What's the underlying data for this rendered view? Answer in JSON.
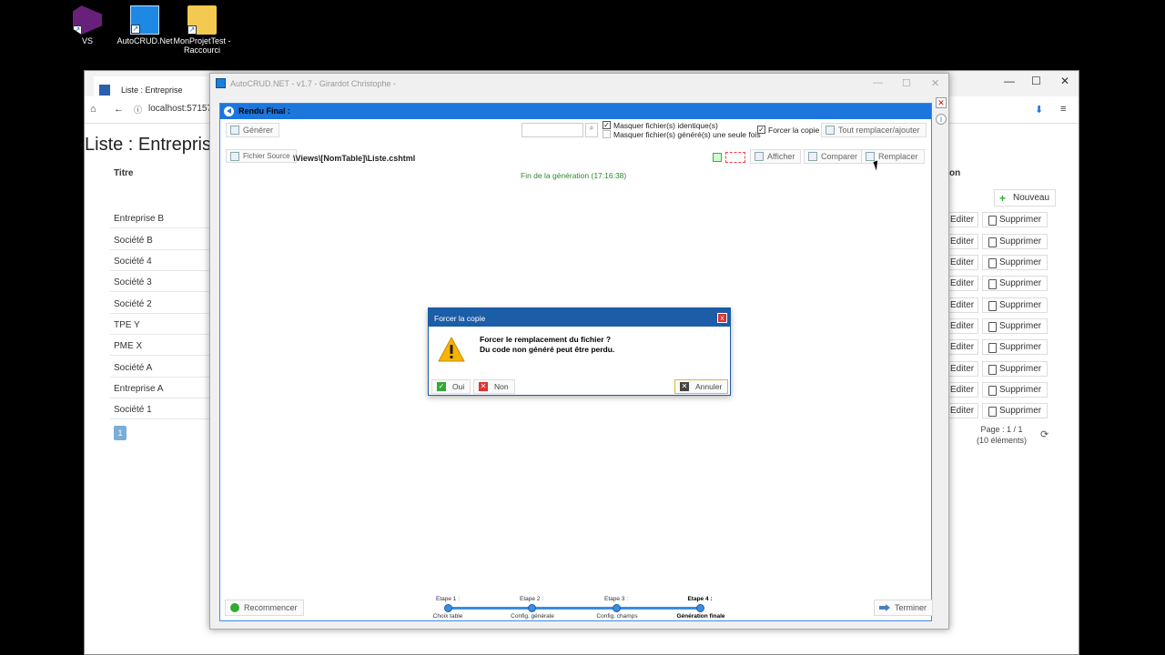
{
  "desktop": {
    "icons": [
      {
        "label": "VS"
      },
      {
        "label": "AutoCRUD.Net"
      },
      {
        "label": "MonProjetTest - Raccourci"
      }
    ]
  },
  "browser": {
    "tab_title": "Liste : Entreprise",
    "address": "localhost:57157",
    "page_title": "Liste : Entrepris",
    "col_titre": "Titre",
    "col_action": "on",
    "new_button": "Nouveau",
    "edit_label": "Editer",
    "delete_label": "Supprimer",
    "rows": [
      "Entreprise B",
      "Société B",
      "Société 4",
      "Société 3",
      "Société 2",
      "TPE Y",
      "PME X",
      "Société A",
      "Entreprise A",
      "Société 1"
    ],
    "pager_current": "1",
    "page_info_line1": "Page : 1 / 1",
    "page_info_line2": "(10 éléments)"
  },
  "app": {
    "title": "AutoCRUD.NET - v1.7 - Girardot Christophe -",
    "panel_title": "Rendu Final :",
    "generer": "Générer",
    "masquer_identiques": "Masquer fichier(s) identique(s)",
    "masquer_une_fois": "Masquer fichier(s) généré(s) une seule fois",
    "forcer_copie": "Forcer la copie",
    "tout_remplacer": "Tout remplacer/ajouter",
    "fichier_source": "Fichier Source",
    "source_path": "\\Views\\[NomTable]\\Liste.cshtml",
    "afficher": "Afficher",
    "comparer": "Comparer",
    "remplacer": "Remplacer",
    "generation_done": "Fin de la génération (17:16:38)",
    "recommencer": "Recommencer",
    "terminer": "Terminer",
    "steps": [
      {
        "top": "Etape 1 :",
        "bottom": "Choix table"
      },
      {
        "top": "Etape 2 :",
        "bottom": "Config. générale"
      },
      {
        "top": "Etape 3 :",
        "bottom": "Config. champs"
      },
      {
        "top": "Etape 4 :",
        "bottom": "Génération finale"
      }
    ]
  },
  "dialog": {
    "title": "Forcer la copie",
    "line1": "Forcer le remplacement du fichier ?",
    "line2": "Du code non généré peut être perdu.",
    "oui": "Oui",
    "non": "Non",
    "annuler": "Annuler"
  },
  "colors": {
    "accent": "#1c76dc",
    "dialog_head": "#1c5da8",
    "success": "#2a8a2a"
  }
}
